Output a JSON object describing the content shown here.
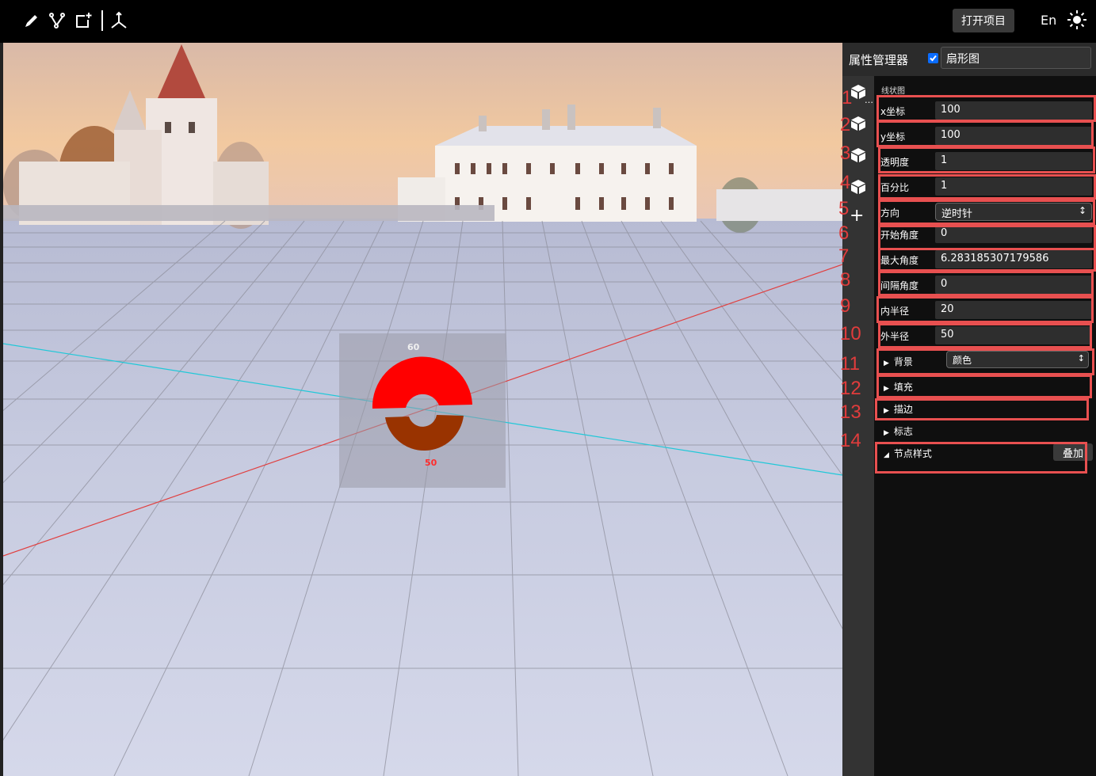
{
  "toolbar": {
    "icons": [
      "pencil-icon",
      "branch-icon",
      "add-frame-icon",
      "axes-icon"
    ],
    "open_project": "打开项目",
    "language": "En",
    "theme_icon": "sun-icon"
  },
  "viewport": {
    "chart": {
      "top_label": "60",
      "bottom_label": "50",
      "colors": {
        "outer_sector": "#ff0000",
        "inner_sector": "#993300",
        "panel": "#9a9aa8"
      }
    },
    "axis_colors": {
      "x_axis": "#e04040",
      "z_axis": "#20c8d8"
    }
  },
  "panel": {
    "title": "属性管理器",
    "enabled": true,
    "name": "扇形图",
    "section": "线状图",
    "properties": [
      {
        "label": "x坐标",
        "value": "100"
      },
      {
        "label": "y坐标",
        "value": "100"
      },
      {
        "label": "透明度",
        "value": "1"
      },
      {
        "label": "百分比",
        "value": "1"
      },
      {
        "label": "方向",
        "value": "逆时针"
      },
      {
        "label": "开始角度",
        "value": "0"
      },
      {
        "label": "最大角度",
        "value": "6.283185307179586"
      },
      {
        "label": "间隔角度",
        "value": "0"
      },
      {
        "label": "内半径",
        "value": "20"
      },
      {
        "label": "外半径",
        "value": "50"
      }
    ],
    "groups": [
      {
        "label": "背景",
        "select": "颜色"
      },
      {
        "label": "填充"
      },
      {
        "label": "描边"
      },
      {
        "label": "标志"
      },
      {
        "label": "节点样式",
        "button": "叠加"
      }
    ]
  },
  "annotations": [
    "1",
    "2",
    "3",
    "4",
    "5",
    "6",
    "7",
    "8",
    "9",
    "10",
    "11",
    "12",
    "13",
    "14"
  ]
}
